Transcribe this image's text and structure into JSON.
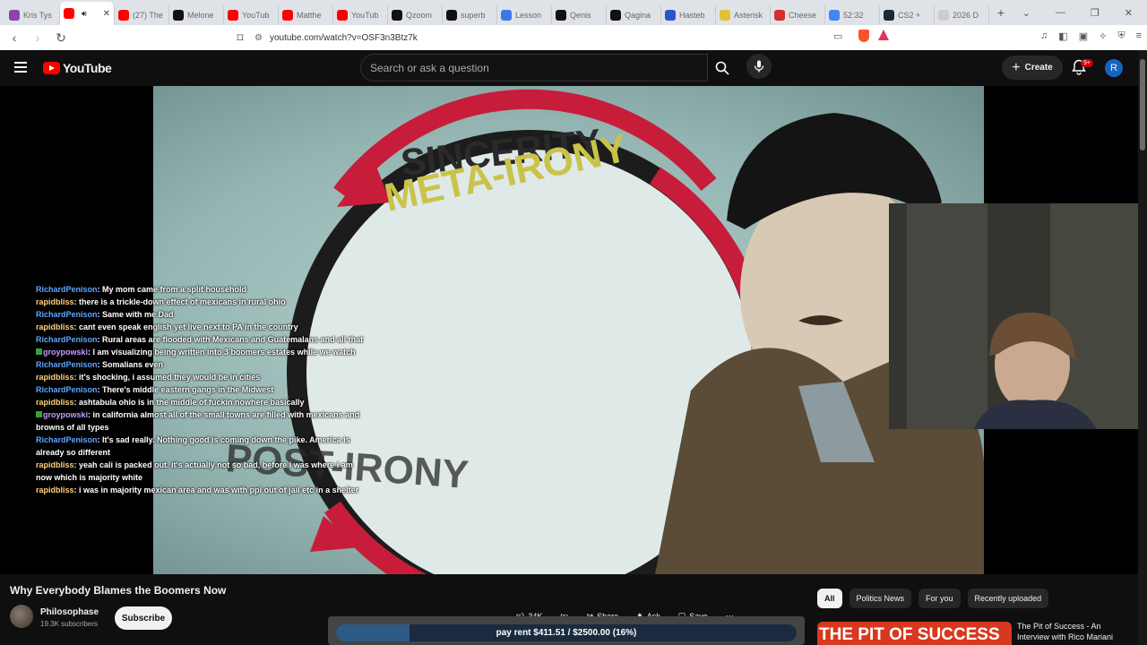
{
  "browser": {
    "tabs": [
      {
        "label": "Kris Tys",
        "color": "#8e44ad"
      },
      {
        "label": "",
        "color": "#ff0000",
        "active": true
      },
      {
        "label": "(27) The",
        "color": "#ff0000"
      },
      {
        "label": "Melone",
        "color": "#111111"
      },
      {
        "label": "YouTub",
        "color": "#ff0000"
      },
      {
        "label": "Matthe",
        "color": "#ff0000"
      },
      {
        "label": "YouTub",
        "color": "#ff0000"
      },
      {
        "label": "Qzoom",
        "color": "#111111"
      },
      {
        "label": "superb",
        "color": "#111111"
      },
      {
        "label": "Lesson",
        "color": "#3b78e7"
      },
      {
        "label": "Qenis",
        "color": "#111111"
      },
      {
        "label": "Qagina",
        "color": "#111111"
      },
      {
        "label": "Hasteb",
        "color": "#2c53c9"
      },
      {
        "label": "Asterisk",
        "color": "#e0c23a"
      },
      {
        "label": "Cheese",
        "color": "#d32f2f"
      },
      {
        "label": "52:32",
        "color": "#4285f4"
      },
      {
        "label": "CS2 +",
        "color": "#1b2838"
      },
      {
        "label": "2026 D",
        "color": "#cccccc"
      }
    ],
    "url": "youtube.com/watch?v=OSF3n3Btz7k"
  },
  "youtube": {
    "logo_text": "YouTube",
    "search_placeholder": "Search or ask a question",
    "create_label": "Create",
    "notif_badge": "9+",
    "avatar_letter": "R"
  },
  "video": {
    "overlay_text_1": "SINCERITY",
    "overlay_text_2": "META-IRONY",
    "overlay_text_3": "POST-IRONY"
  },
  "chat": [
    {
      "user": "RichardPenison",
      "msg": "My mom came from a split household",
      "cls": "u1"
    },
    {
      "user": "rapidbliss",
      "msg": "there is a trickle-down effect of mexicans in rural ohio",
      "cls": "u2"
    },
    {
      "user": "RichardPenison",
      "msg": "Same with me Dad",
      "cls": "u1"
    },
    {
      "user": "rapidbliss",
      "msg": "cant even speak english yet live next to PA in the country",
      "cls": "u2"
    },
    {
      "user": "RichardPenison",
      "msg": "Rural areas are flooded with Mexicans and Guatemalans and all that",
      "cls": "u1"
    },
    {
      "user": "groypowski",
      "msg": "I am visualizing being written into 3 boomers estates while we watch",
      "cls": "u3",
      "sq": true
    },
    {
      "user": "RichardPenison",
      "msg": "Somalians even",
      "cls": "u1"
    },
    {
      "user": "rapidbliss",
      "msg": "it's shocking, i assumed they would be in cities",
      "cls": "u2"
    },
    {
      "user": "RichardPenison",
      "msg": "There's middle eastern gangs in the Midwest",
      "cls": "u1"
    },
    {
      "user": "rapidbliss",
      "msg": "ashtabula ohio is in the middle of fuckin nowhere basically",
      "cls": "u2"
    },
    {
      "user": "groypowski",
      "msg": "in california almost all of the small towns are filled with mexicans and browns of all types",
      "cls": "u3",
      "sq": true
    },
    {
      "user": "RichardPenison",
      "msg": "It's sad really. Nothing good is coming down the pike. America is already so different",
      "cls": "u1"
    },
    {
      "user": "rapidbliss",
      "msg": "yeah cali is packed out. it's actually not so bad, before i was where i am now which is majority white",
      "cls": "u2"
    },
    {
      "user": "rapidbliss",
      "msg": "i was in majority mexican area and was with ppl out of jail etc in a shelter",
      "cls": "u2"
    }
  ],
  "meta": {
    "title": "Why Everybody Blames the Boomers Now",
    "channel": "Philosophase",
    "subs": "19.3K subscribers",
    "subscribe": "Subscribe",
    "likes": "34K",
    "share": "Share",
    "ask": "Ask",
    "save": "Save"
  },
  "progress": {
    "text": "pay rent $411.51 / $2500.00 (16%)",
    "fraction": 0.16
  },
  "chips": [
    "All",
    "Politics News",
    "For you",
    "Recently uploaded"
  ],
  "recommended": {
    "thumb_text": "THE PIT OF SUCCESS",
    "title": "The Pit of Success - An Interview with Rico Mariani"
  }
}
